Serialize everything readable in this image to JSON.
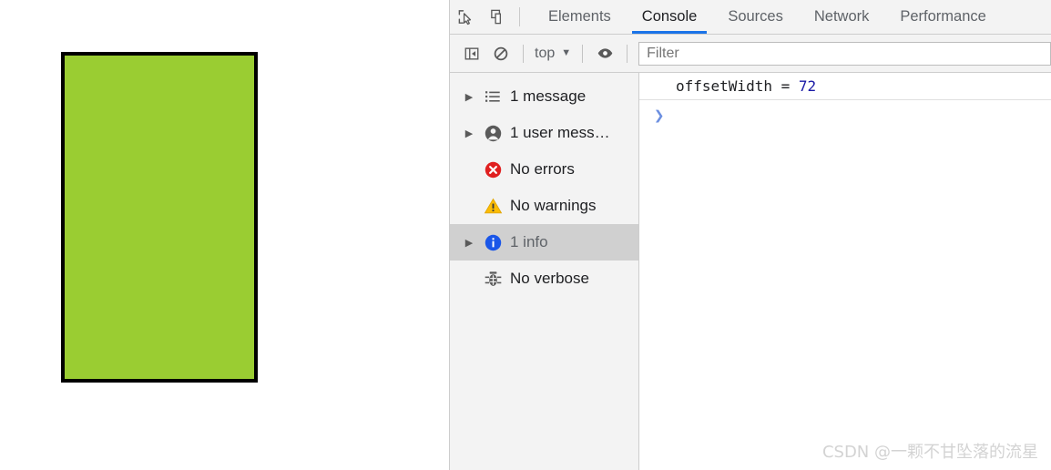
{
  "page": {
    "green_box": {
      "fill_color": "#9acd32",
      "border_color": "#000000"
    }
  },
  "devtools": {
    "toolbar": {
      "inspect_icon": "inspect-element-icon",
      "device_icon": "device-toolbar-icon",
      "tabs": [
        {
          "label": "Elements",
          "active": false
        },
        {
          "label": "Console",
          "active": true
        },
        {
          "label": "Sources",
          "active": false
        },
        {
          "label": "Network",
          "active": false
        },
        {
          "label": "Performance",
          "active": false
        }
      ],
      "active_tab_underline_color": "#1a73e8"
    },
    "filterbar": {
      "sidebar_toggle_icon": "sidebar-toggle-icon",
      "clear_console_icon": "clear-console-icon",
      "context_label": "top",
      "context_caret": "▼",
      "eye_icon": "live-expression-eye-icon",
      "filter_placeholder": "Filter",
      "filter_value": ""
    },
    "sidebar": {
      "items": [
        {
          "label": "1 message",
          "icon": "list-icon",
          "expandable": true,
          "selected": false
        },
        {
          "label": "1 user mess…",
          "icon": "user-icon",
          "expandable": true,
          "selected": false
        },
        {
          "label": "No errors",
          "icon": "error-icon",
          "expandable": false,
          "selected": false
        },
        {
          "label": "No warnings",
          "icon": "warning-icon",
          "expandable": false,
          "selected": false
        },
        {
          "label": "1 info",
          "icon": "info-icon",
          "expandable": true,
          "selected": true
        },
        {
          "label": "No verbose",
          "icon": "bug-icon",
          "expandable": false,
          "selected": false
        }
      ]
    },
    "console": {
      "messages": [
        {
          "text_prefix": "offsetWidth = ",
          "value": "72",
          "value_color": "#1a1aa6"
        }
      ],
      "prompt_symbol": "❯"
    }
  },
  "watermark": {
    "text": "CSDN @一颗不甘坠落的流星"
  }
}
